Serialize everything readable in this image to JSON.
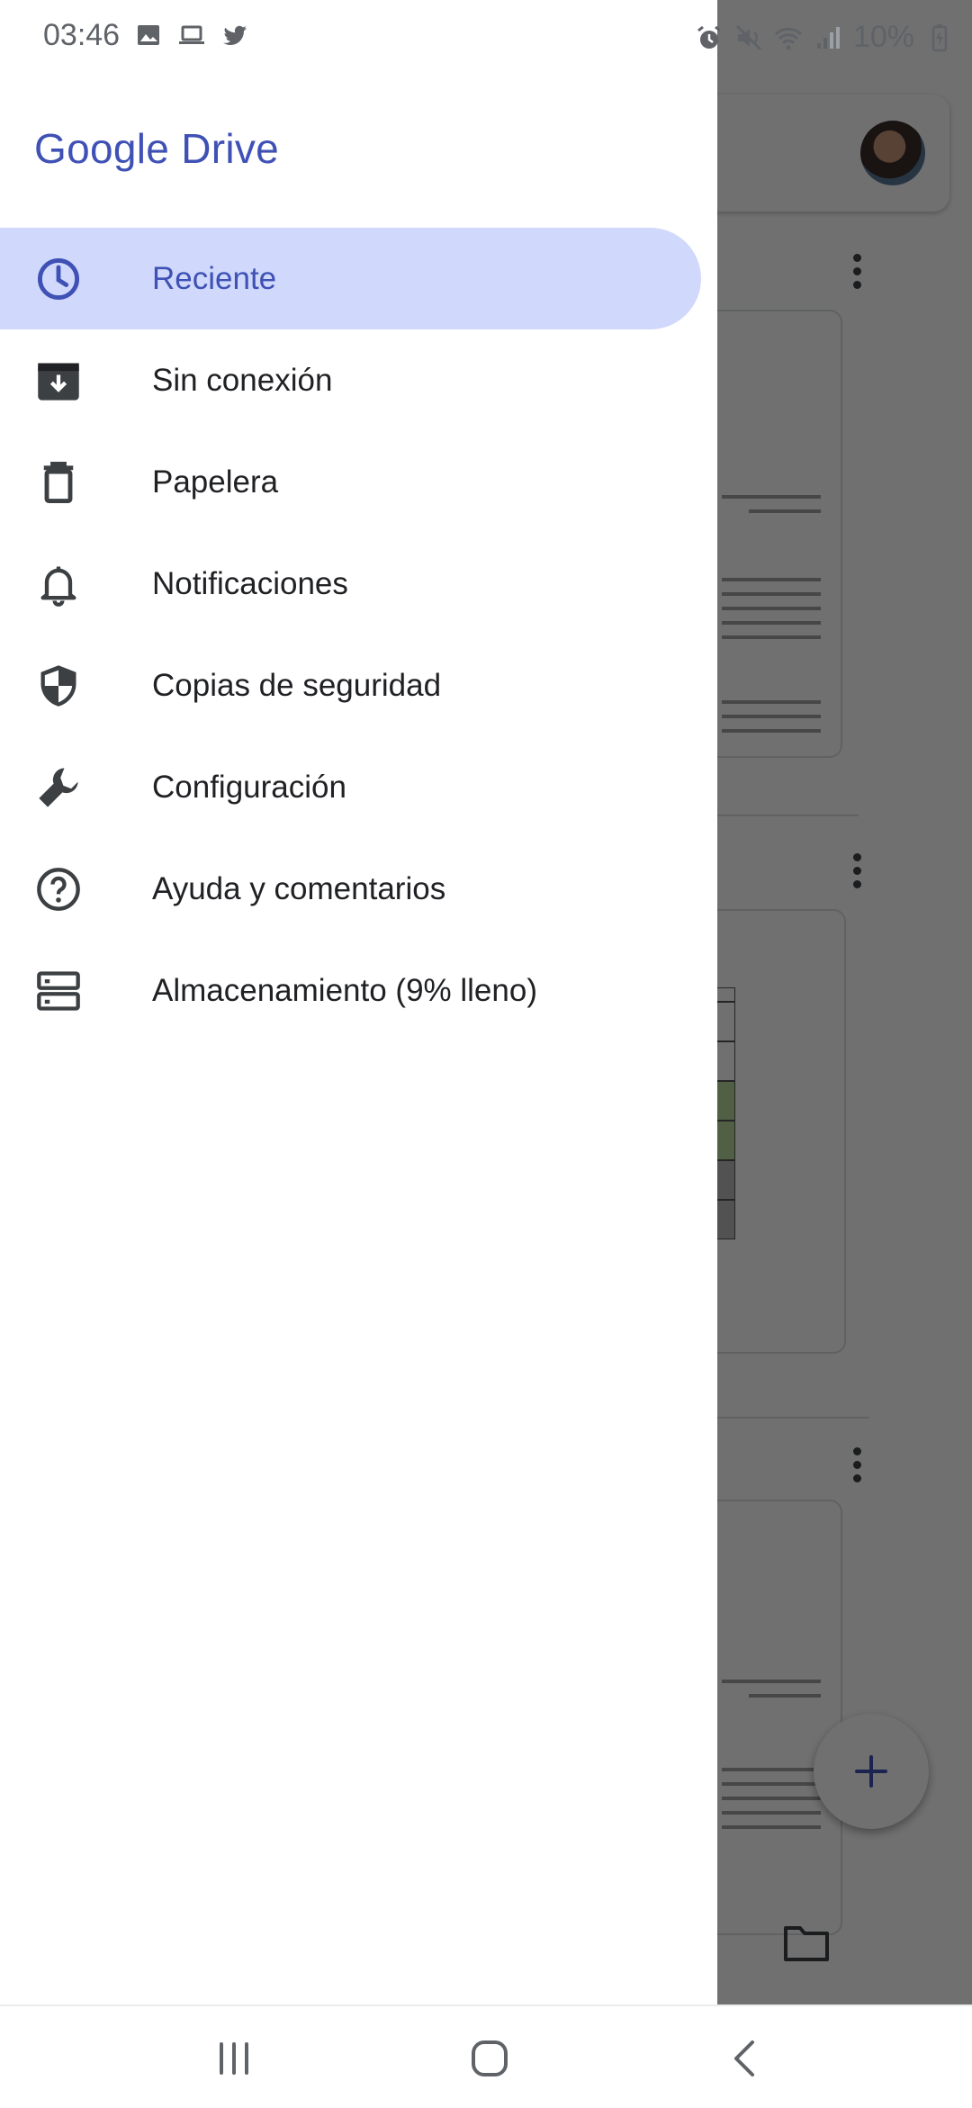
{
  "status_bar": {
    "time": "03:46",
    "battery": "10%",
    "left_icons": [
      "image-icon",
      "laptop-icon",
      "twitter-icon"
    ],
    "right_icons": [
      "alarm-icon",
      "mute-icon",
      "wifi-icon",
      "signal-icon",
      "battery-charging-icon"
    ]
  },
  "drawer": {
    "title": "Google Drive",
    "items": [
      {
        "label": "Reciente",
        "icon": "clock-icon",
        "active": true
      },
      {
        "label": "Sin conexión",
        "icon": "offline-icon",
        "active": false
      },
      {
        "label": "Papelera",
        "icon": "trash-icon",
        "active": false
      },
      {
        "label": "Notificaciones",
        "icon": "bell-icon",
        "active": false
      },
      {
        "label": "Copias de seguridad",
        "icon": "backup-shield-icon",
        "active": false
      },
      {
        "label": "Configuración",
        "icon": "wrench-icon",
        "active": false
      },
      {
        "label": "Ayuda y comentarios",
        "icon": "help-icon",
        "active": false
      },
      {
        "label": "Almacenamiento (9% lleno)",
        "icon": "storage-icon",
        "active": false
      }
    ]
  },
  "colors": {
    "accent": "#3f51b5",
    "active_background": "#d0d9fb",
    "scrim": "rgba(0,0,0,0.56)"
  },
  "nav_bar": {
    "buttons": [
      "recent-apps-icon",
      "home-icon",
      "back-icon"
    ]
  }
}
